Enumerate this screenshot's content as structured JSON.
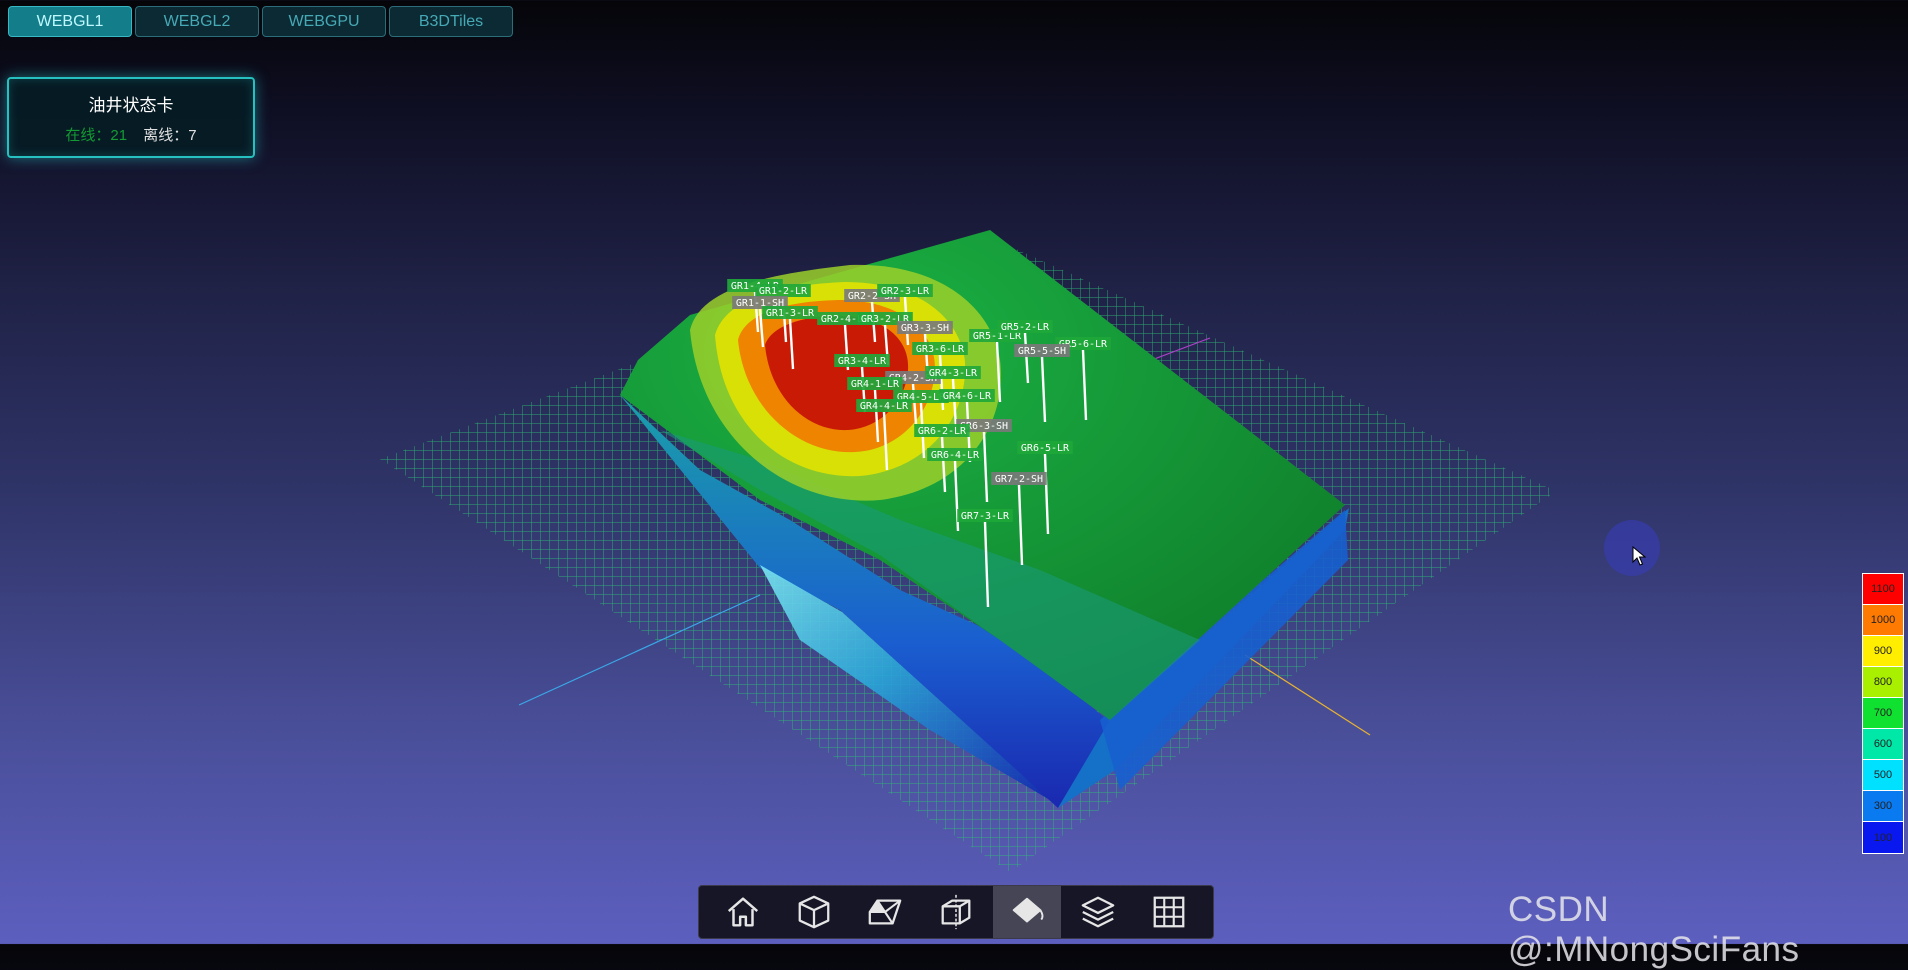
{
  "tabs": [
    {
      "label": "WEBGL1",
      "active": true
    },
    {
      "label": "WEBGL2",
      "active": false
    },
    {
      "label": "WEBGPU",
      "active": false
    },
    {
      "label": "B3DTiles",
      "active": false
    }
  ],
  "status_card": {
    "title": "油井状态卡",
    "online_label": "在线：",
    "online_count": "21",
    "offline_label": "离线：",
    "offline_count": "7"
  },
  "wells": [
    {
      "label": "GR1-4-LR",
      "status": "online"
    },
    {
      "label": "GR1-2-LR",
      "status": "online"
    },
    {
      "label": "GR1-1-SH",
      "status": "offline"
    },
    {
      "label": "GR1-3-LR",
      "status": "online"
    },
    {
      "label": "GR2-2-SH",
      "status": "offline"
    },
    {
      "label": "GR2-3-LR",
      "status": "online"
    },
    {
      "label": "GR2-4-LR",
      "status": "online"
    },
    {
      "label": "GR3-2-LR",
      "status": "online"
    },
    {
      "label": "GR3-3-SH",
      "status": "offline"
    },
    {
      "label": "GR5-1-LR",
      "status": "online"
    },
    {
      "label": "GR5-2-LR",
      "status": "online"
    },
    {
      "label": "GR5-6-LR",
      "status": "online"
    },
    {
      "label": "GR5-5-SH",
      "status": "offline"
    },
    {
      "label": "GR3-6-LR",
      "status": "online"
    },
    {
      "label": "GR3-4-LR",
      "status": "online"
    },
    {
      "label": "GR4-2-SH",
      "status": "offline"
    },
    {
      "label": "GR4-3-LR",
      "status": "online"
    },
    {
      "label": "GR4-1-LR",
      "status": "online"
    },
    {
      "label": "GR4-5-LR",
      "status": "online"
    },
    {
      "label": "GR4-6-LR",
      "status": "online"
    },
    {
      "label": "GR4-4-LR",
      "status": "online"
    },
    {
      "label": "GR6-3-SH",
      "status": "offline"
    },
    {
      "label": "GR6-2-LR",
      "status": "online"
    },
    {
      "label": "GR6-5-LR",
      "status": "online"
    },
    {
      "label": "GR6-4-LR",
      "status": "online"
    },
    {
      "label": "GR7-2-SH",
      "status": "offline"
    },
    {
      "label": "GR7-3-LR",
      "status": "online"
    }
  ],
  "legend": [
    {
      "value": "1100",
      "color": "#ff0000"
    },
    {
      "value": "1000",
      "color": "#ff7a00"
    },
    {
      "value": "900",
      "color": "#ffee00"
    },
    {
      "value": "800",
      "color": "#a8f000"
    },
    {
      "value": "700",
      "color": "#10e030"
    },
    {
      "value": "600",
      "color": "#00e8a8"
    },
    {
      "value": "500",
      "color": "#00e0ff"
    },
    {
      "value": "300",
      "color": "#0a7af0"
    },
    {
      "value": "100",
      "color": "#0a18f0"
    }
  ],
  "toolbar": [
    {
      "name": "home-icon",
      "active": false
    },
    {
      "name": "cube-icon",
      "active": false
    },
    {
      "name": "section-view-icon",
      "active": false
    },
    {
      "name": "clip-box-icon",
      "active": false
    },
    {
      "name": "fill-bucket-icon",
      "active": true
    },
    {
      "name": "layers-icon",
      "active": false
    },
    {
      "name": "grid-icon",
      "active": false
    }
  ],
  "watermark": "CSDN @:MNongSciFans",
  "colors": {
    "accent": "#27c0c0",
    "online": "#139a33",
    "tab_active": "#137d8a"
  }
}
